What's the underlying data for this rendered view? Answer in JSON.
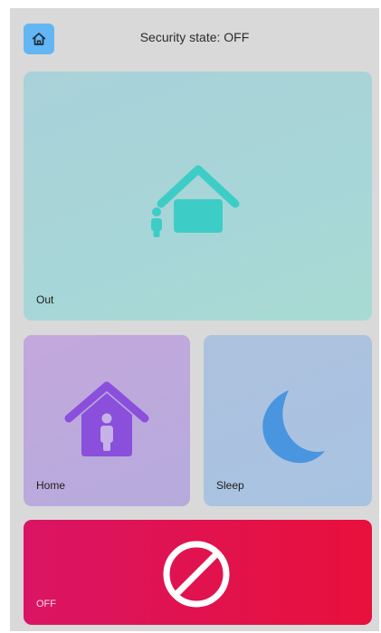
{
  "header": {
    "title": "Security state: OFF",
    "home_icon": "home-icon"
  },
  "modes": {
    "out": {
      "label": "Out",
      "icon": "house-person-outside-icon",
      "color": "#3dcdc6"
    },
    "home": {
      "label": "Home",
      "icon": "house-person-inside-icon",
      "color": "#8a4fdb"
    },
    "sleep": {
      "label": "Sleep",
      "icon": "crescent-moon-icon",
      "color": "#4a95df"
    },
    "off": {
      "label": "OFF",
      "icon": "prohibited-icon",
      "color": "#e2124a"
    }
  },
  "colors": {
    "accent_home_button": "#62b6f4",
    "screen_background": "#d9d9d9"
  }
}
